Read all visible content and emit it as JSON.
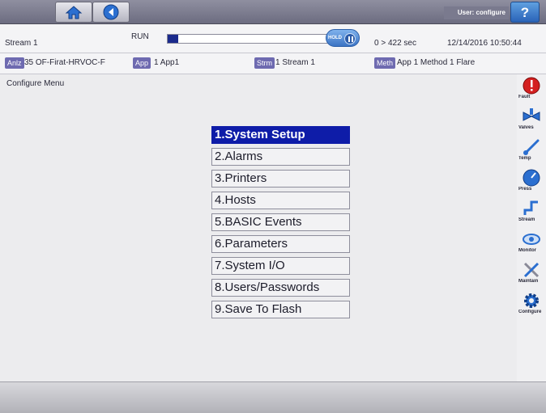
{
  "toolbar": {
    "user_label": "User: configure",
    "home_icon": "home-icon",
    "back_icon": "back-arrow-icon",
    "help_icon": "help-icon",
    "help_label": "?"
  },
  "status": {
    "stream_name": "Stream 1",
    "run_state": "RUN",
    "progress_fraction": 0.06,
    "hold_label": "HOLD",
    "cycle_time": "0 > 422 sec",
    "datetime": "12/14/2016 10:50:44"
  },
  "info": {
    "anlz_tag": "Anlz",
    "anlz_value": "35 OF-Firat-HRVOC-F",
    "app_tag": "App",
    "app_value": "1 App1",
    "strm_tag": "Strm",
    "strm_value": "1 Stream 1",
    "meth_tag": "Meth",
    "meth_value": "App 1 Method 1 Flare"
  },
  "main": {
    "title": "Configure Menu",
    "menu_items": [
      "1.System Setup",
      "2.Alarms",
      "3.Printers",
      "4.Hosts",
      "5.BASIC Events",
      "6.Parameters",
      "7.System I/O",
      "8.Users/Passwords",
      "9.Save To Flash"
    ],
    "selected_index": 0
  },
  "sidebar": {
    "items": [
      {
        "label": "Fault",
        "icon": "fault-icon"
      },
      {
        "label": "Valves",
        "icon": "valves-icon"
      },
      {
        "label": "Temp",
        "icon": "temp-icon"
      },
      {
        "label": "Press",
        "icon": "press-icon"
      },
      {
        "label": "Stream",
        "icon": "stream-icon"
      },
      {
        "label": "Monitor",
        "icon": "monitor-icon"
      },
      {
        "label": "Maintain",
        "icon": "maintain-icon"
      },
      {
        "label": "Configure",
        "icon": "configure-icon"
      }
    ]
  },
  "colors": {
    "accent": "#0e1ca8",
    "tag": "#6e6ab0",
    "fault": "#d42020"
  }
}
